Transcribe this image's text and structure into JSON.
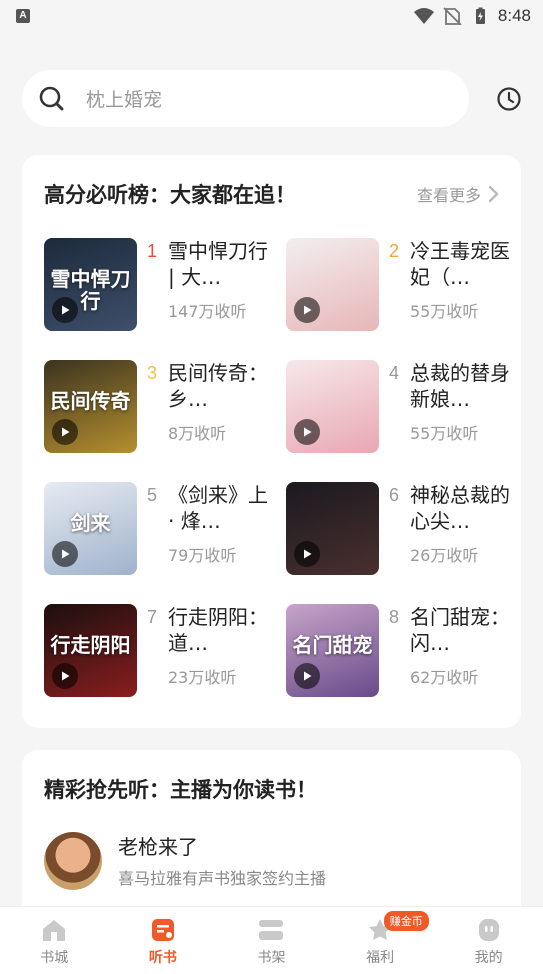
{
  "status_bar": {
    "app_indicator": "A",
    "time": "8:48"
  },
  "search": {
    "placeholder": "枕上婚宠"
  },
  "ranking": {
    "title": "高分必听榜：大家都在追！",
    "more_label": "查看更多",
    "items": [
      {
        "rank": "1",
        "title": "雪中悍刀行 | 大…",
        "listens": "147万收听",
        "rank_color": "#f04a3a",
        "cover_colors": [
          "#1d2a3c",
          "#3f4f6a"
        ],
        "cover_text": "雪中悍刀行"
      },
      {
        "rank": "2",
        "title": "冷王毒宠医妃（…",
        "listens": "55万收听",
        "rank_color": "#f5a340",
        "cover_colors": [
          "#f3eef0",
          "#e7b6b7"
        ],
        "cover_text": ""
      },
      {
        "rank": "3",
        "title": "民间传奇：乡…",
        "listens": "8万收听",
        "rank_color": "#f5c040",
        "cover_colors": [
          "#3a3320",
          "#b6902f"
        ],
        "cover_text": "民间传奇"
      },
      {
        "rank": "4",
        "title": "总裁的替身新娘…",
        "listens": "55万收听",
        "rank_color": "#999999",
        "cover_colors": [
          "#f7e8ea",
          "#e8a7b3"
        ],
        "cover_text": ""
      },
      {
        "rank": "5",
        "title": "《剑来》上 · 烽…",
        "listens": "79万收听",
        "rank_color": "#999999",
        "cover_colors": [
          "#e7ebf1",
          "#9fb2cc"
        ],
        "cover_text": "剑来"
      },
      {
        "rank": "6",
        "title": "神秘总裁的心尖…",
        "listens": "26万收听",
        "rank_color": "#999999",
        "cover_colors": [
          "#1a1a1f",
          "#4a2f2f"
        ],
        "cover_text": ""
      },
      {
        "rank": "7",
        "title": "行走阴阳：道…",
        "listens": "23万收听",
        "rank_color": "#999999",
        "cover_colors": [
          "#1b0f0f",
          "#8a1e1e"
        ],
        "cover_text": "行走阴阳"
      },
      {
        "rank": "8",
        "title": "名门甜宠：闪…",
        "listens": "62万收听",
        "rank_color": "#999999",
        "cover_colors": [
          "#c5a5c8",
          "#6a4a8a"
        ],
        "cover_text": "名门甜宠"
      }
    ]
  },
  "anchors": {
    "title": "精彩抢先听：主播为你读书！",
    "items": [
      {
        "name": "老枪来了",
        "desc": "喜马拉雅有声书独家签约主播"
      }
    ]
  },
  "bottom_nav": {
    "items": [
      {
        "label": "书城",
        "icon": "home-icon"
      },
      {
        "label": "听书",
        "icon": "audiobook-icon",
        "active": true
      },
      {
        "label": "书架",
        "icon": "bookshelf-icon"
      },
      {
        "label": "福利",
        "icon": "gift-icon",
        "badge": "赚金币"
      },
      {
        "label": "我的",
        "icon": "profile-icon"
      }
    ]
  },
  "colors": {
    "accent": "#f05a28",
    "background": "#f5f5f5"
  }
}
